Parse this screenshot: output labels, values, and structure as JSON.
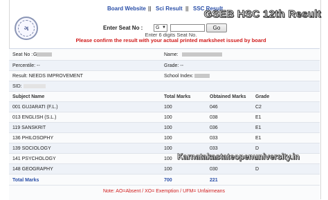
{
  "nav": {
    "board_website": "Board Website",
    "sep1": "||",
    "sci_result": "Sci Result",
    "sep2": "||",
    "ssc_result": "SSC Result"
  },
  "overlay_title": "GSEB HSC 12th Result",
  "seat_form": {
    "label": "Enter Seat No :",
    "prefix": "G",
    "go": "Go",
    "hint": "Enter 6 digits Seat No.",
    "warning": "Please confirm the result with your actual printed marksheet issued by board"
  },
  "info": {
    "seat_label": "Seat No :",
    "seat_value": "G",
    "name_label": "Name:",
    "percentile_label": "Percentile:",
    "percentile_value": "--",
    "grade_label": "Grade:",
    "grade_value": "--",
    "result_label": "Result:",
    "result_value": "NEEDS IMPROVEMENT",
    "school_label": "School Index:",
    "sid_label": "SID:"
  },
  "table": {
    "headers": [
      "Subject Name",
      "Total Marks",
      "Obtained Marks",
      "Grade"
    ],
    "rows": [
      [
        "001 GUJARATI (F.L.)",
        "100",
        "046",
        "C2"
      ],
      [
        "013 ENGLISH (S.L.)",
        "100",
        "038",
        "E1"
      ],
      [
        "119 SANSKRIT",
        "100",
        "036",
        "E1"
      ],
      [
        "136 PHILOSOPHY",
        "100",
        "033",
        "E1"
      ],
      [
        "139 SOCIOLOGY",
        "100",
        "033",
        "D"
      ],
      [
        "141 PSYCHOLOGY",
        "100",
        "035",
        "E1"
      ],
      [
        "148 GEOGRAPHY",
        "100",
        "030",
        "D"
      ]
    ],
    "total_label": "Total Marks",
    "total_max": "700",
    "total_obtained": "221"
  },
  "note": {
    "label": "Note",
    "text": ": AO=Absent / XO= Exemption / UFM= Unfairmeans"
  },
  "watermark": "Karnatakastateopenuniversity.in",
  "logo_icon": "gseb-emblem-icon"
}
